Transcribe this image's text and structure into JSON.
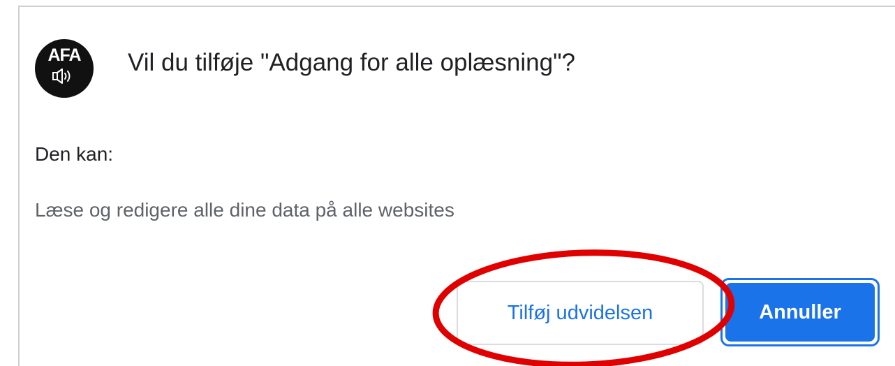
{
  "dialog": {
    "icon": {
      "name": "afa-speaker-logo",
      "text": "AFA"
    },
    "title": "Vil du tilføje \"Adgang for alle oplæsning\"?",
    "permissions_heading": "Den kan:",
    "permissions": [
      "Læse og redigere alle dine data på alle websites"
    ],
    "buttons": {
      "add_label": "Tilføj udvidelsen",
      "cancel_label": "Annuller"
    }
  },
  "annotation": {
    "ring_color": "#e00000",
    "target": "add-extension-button"
  },
  "colors": {
    "accent": "#1a73e8",
    "text_primary": "#202124",
    "text_secondary": "#5f6368",
    "border": "#dadce0"
  }
}
